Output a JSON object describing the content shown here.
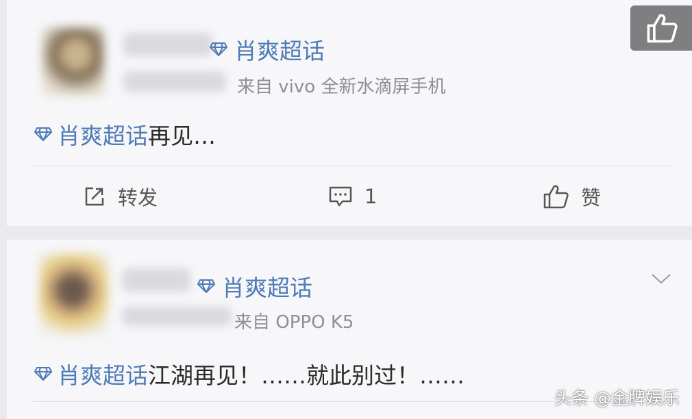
{
  "posts": [
    {
      "topic": "肖爽超话",
      "source": "来自 vivo 全新水滴屏手机",
      "text_topic": "肖爽超话",
      "text_body": "再见…",
      "actions": {
        "repost": "转发",
        "comment": "1",
        "like": "赞"
      }
    },
    {
      "topic": "肖爽超话",
      "source": "来自 OPPO K5",
      "text_topic": "肖爽超话",
      "text_body": "江湖再见！……就此别过！……"
    }
  ],
  "watermark": "头条 @金牌娱乐",
  "colors": {
    "topic": "#4e7bb6",
    "text": "#2a2a2a",
    "muted": "#8e8e93",
    "card": "#f7f7fa"
  },
  "icons": [
    "diamond-icon",
    "share-icon",
    "comment-icon",
    "thumbs-up-icon",
    "chevron-down-icon"
  ]
}
